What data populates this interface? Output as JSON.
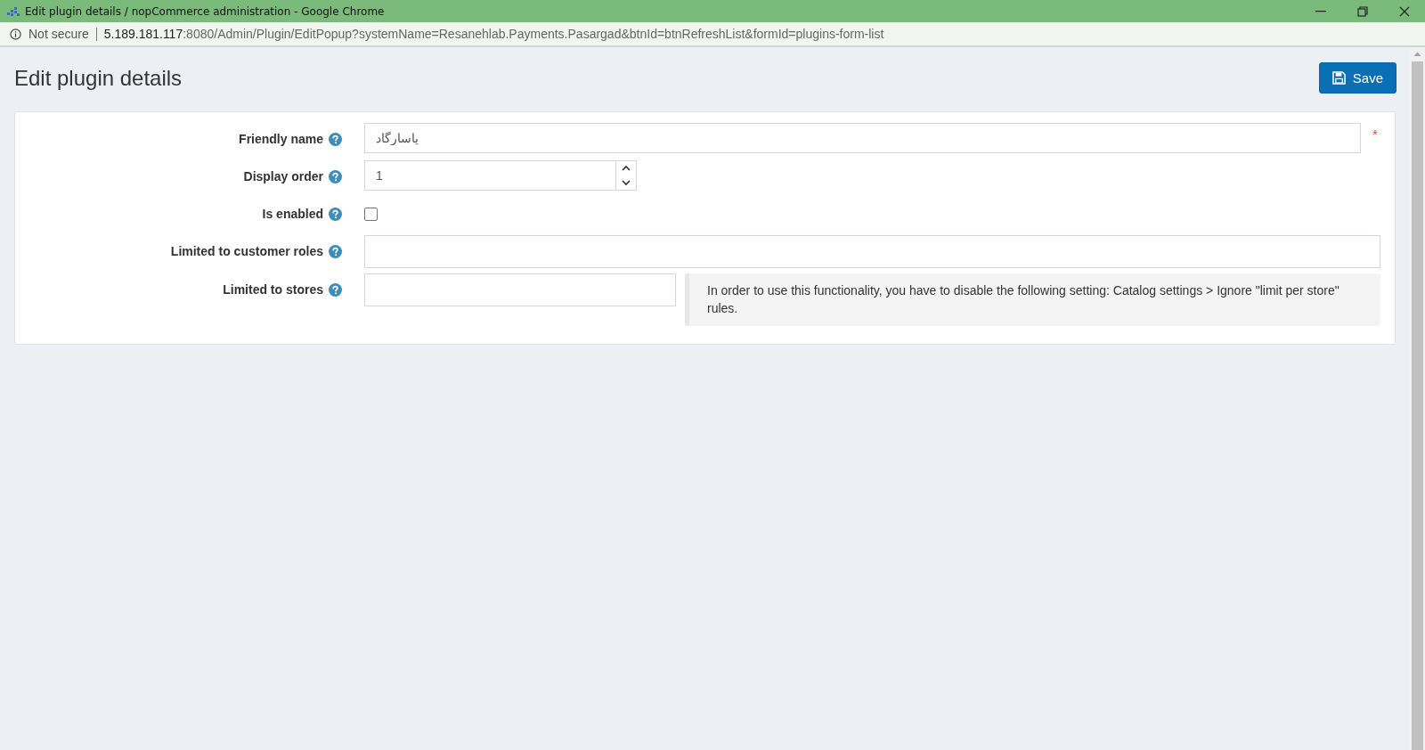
{
  "window": {
    "title": "Edit plugin details / nopCommerce administration - Google Chrome"
  },
  "address_bar": {
    "security": "Not secure",
    "host": "5.189.181.117",
    "path": ":8080/Admin/Plugin/EditPopup?systemName=Resanehlab.Payments.Pasargad&btnId=btnRefreshList&formId=plugins-form-list"
  },
  "page": {
    "title": "Edit plugin details",
    "save_button": "Save"
  },
  "fields": [
    {
      "kind": "text",
      "label": "Friendly name",
      "value": "پاسارگاد",
      "required_mark": "*"
    },
    {
      "kind": "number",
      "label": "Display order",
      "value": "1"
    },
    {
      "kind": "checkbox",
      "label": "Is enabled",
      "checked": false
    },
    {
      "kind": "multiselect",
      "label": "Limited to customer roles"
    },
    {
      "kind": "multiselect",
      "label": "Limited to stores",
      "note": "In order to use this functionality, you have to disable the following setting: Catalog settings > Ignore \"limit per store\" rules."
    }
  ]
}
